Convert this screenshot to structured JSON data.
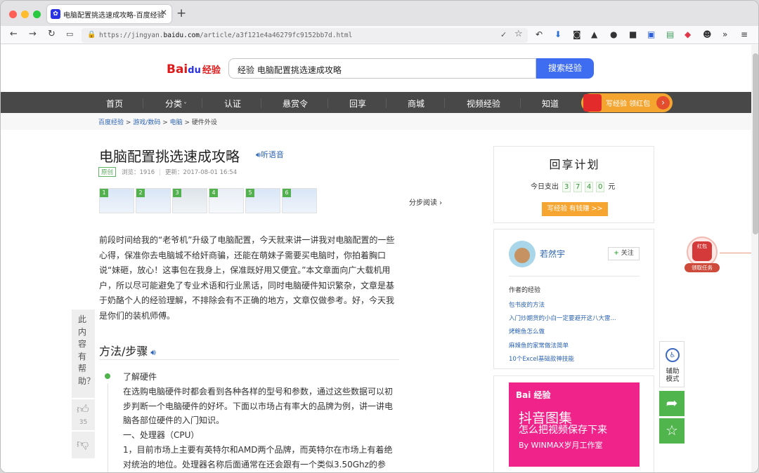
{
  "browser": {
    "tab_title": "电脑配置挑选速成攻略-百度经验",
    "url_prefix": "https://jingyan.",
    "url_domain": "baidu.com",
    "url_path": "/article/a3f121e4a46279fc9152bb7d.html"
  },
  "site": {
    "logo_text": "Bai",
    "logo_paw": "du",
    "logo_suffix": "经验",
    "search_value": "经验 电脑配置挑选速成攻略",
    "search_button": "搜索经验"
  },
  "menu": [
    "首页",
    "分类",
    "认证",
    "悬赏令",
    "回享",
    "商城",
    "视频经验",
    "知道"
  ],
  "promo": "写经验 领红包",
  "breadcrumb": {
    "c1": "百度经验",
    "c2": "游戏/数码",
    "c3": "电脑",
    "c4": "硬件外设",
    "sep": " > "
  },
  "article": {
    "title": "电脑配置挑选速成攻略",
    "listen": "听语音",
    "badge": "原创",
    "views": "浏览：1916",
    "updated": "更新：2017-08-01 16:54",
    "step_read": "分步阅读",
    "intro": "前段时间给我的“老爷机”升级了电脑配置，今天就来讲一讲我对电脑配置的一些心得，保准你去电脑城不给奸商骗，还能在萌妹子需要买电脑时，你拍着胸口说“妹砸，放心！这事包在我身上，保准既好用又便宜。”本文章面向广大载机用户，所以尽可能避免了专业术语和行业黑话，同时电脑硬件知识繁杂，文章是基于奶酪个人的经验理解，不排除会有不正确的地方，文章仅做参考。好，今天我是你们的装机师傅。",
    "section": "方法/步骤",
    "step1_title": "了解硬件",
    "step1_text": "在选购电脑硬件时都会看到各种各样的型号和参数，通过这些数据可以初步判断一个电脑硬件的好坏。下面以市场占有率大的品牌为例，讲一讲电脑各部位硬件的入门知识。",
    "step1_sub": "一、处理器（CPU）",
    "step1_p1": "1，目前市场上主要有英特尔和AMD两个品牌，而英特尔在市场上有着绝对统治的地位。处理器名称后面通常在还会跟有一个类似3.50Ghz的参数，代"
  },
  "help_side": {
    "label": "此内容有帮助？",
    "likes": "35"
  },
  "plan": {
    "title": "回享计划",
    "today_label": "今日支出",
    "digits": [
      "3",
      "7",
      "4",
      "0"
    ],
    "unit": "元",
    "cta": "写经验 有钱赚 >>"
  },
  "author": {
    "name": "若然宇",
    "follow": "关注",
    "section": "作者的经验",
    "links": [
      "包书皮的方法",
      "入门炒期货的小白一定要避开这八大雷...",
      "烤鲍鱼怎么做",
      "麻辣鱼的家常做法简单",
      "10个Excel基础款神技能"
    ]
  },
  "ad": {
    "logo": "Bai 经验",
    "line1": "抖音图集",
    "line2": "怎么把视频保存下来",
    "line3": "By WINMAX岁月工作室"
  },
  "float": {
    "redbag": "红包",
    "task": "领取任务",
    "assist": "辅助模式"
  }
}
